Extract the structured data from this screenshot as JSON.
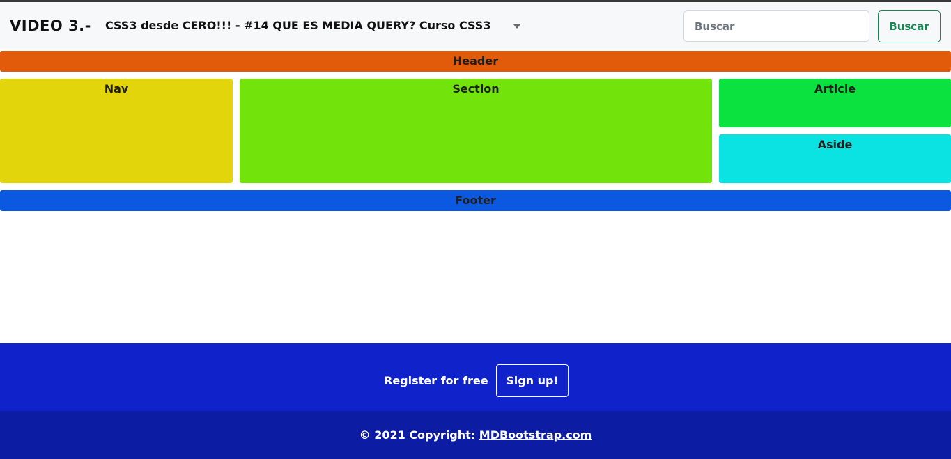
{
  "navbar": {
    "brand": "VIDEO 3.-",
    "dropdown_label": "CSS3 desde CERO!!! - #14 QUE ES MEDIA QUERY? Curso CSS3",
    "search": {
      "placeholder": "Buscar",
      "value": ""
    },
    "search_button": "Buscar"
  },
  "layout": {
    "header": "Header",
    "nav": "Nav",
    "section": "Section",
    "article": "Article",
    "aside": "Aside",
    "footer": "Footer"
  },
  "site_footer": {
    "register_text": "Register for free",
    "signup_button": "Sign up!",
    "copyright_prefix": "© 2021 Copyright: ",
    "copyright_link": "MDBootstrap.com"
  },
  "colors": {
    "header": "#e15b0b",
    "nav": "#e2d50b",
    "section": "#72e30b",
    "article": "#0be23f",
    "aside": "#0be2e2",
    "footer": "#0b58e1",
    "site_footer": "#1022c9",
    "copyright_bar": "#0c1ca3",
    "search_button": "#198754"
  }
}
